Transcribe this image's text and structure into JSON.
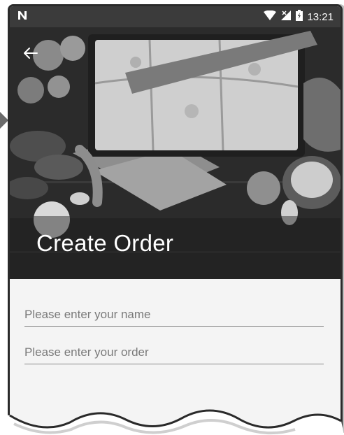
{
  "status_bar": {
    "notification_icon": "n-logo-icon",
    "icons": [
      "wifi-icon",
      "no-signal-icon",
      "battery-icon"
    ],
    "time": "13:21"
  },
  "toolbar": {
    "back_icon": "arrow-left-icon"
  },
  "hero": {
    "title": "Create Order"
  },
  "form": {
    "name_placeholder": "Please enter your name",
    "order_placeholder": "Please enter your order"
  }
}
